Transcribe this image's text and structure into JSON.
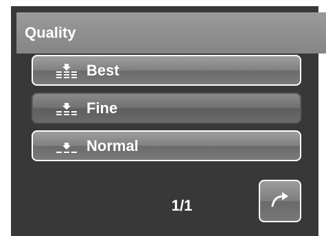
{
  "header": {
    "title": "Quality"
  },
  "options": [
    {
      "label": "Best",
      "icon": "quality-best-icon",
      "selected": false
    },
    {
      "label": "Fine",
      "icon": "quality-fine-icon",
      "selected": true
    },
    {
      "label": "Normal",
      "icon": "quality-normal-icon",
      "selected": false
    }
  ],
  "pager": {
    "text": "1/1",
    "next_icon": "redo-arrow-icon"
  },
  "colors": {
    "background": "#383838",
    "title_bar": "#8f8f8f",
    "button": "#7e7e7e",
    "border": "#ffffff"
  }
}
